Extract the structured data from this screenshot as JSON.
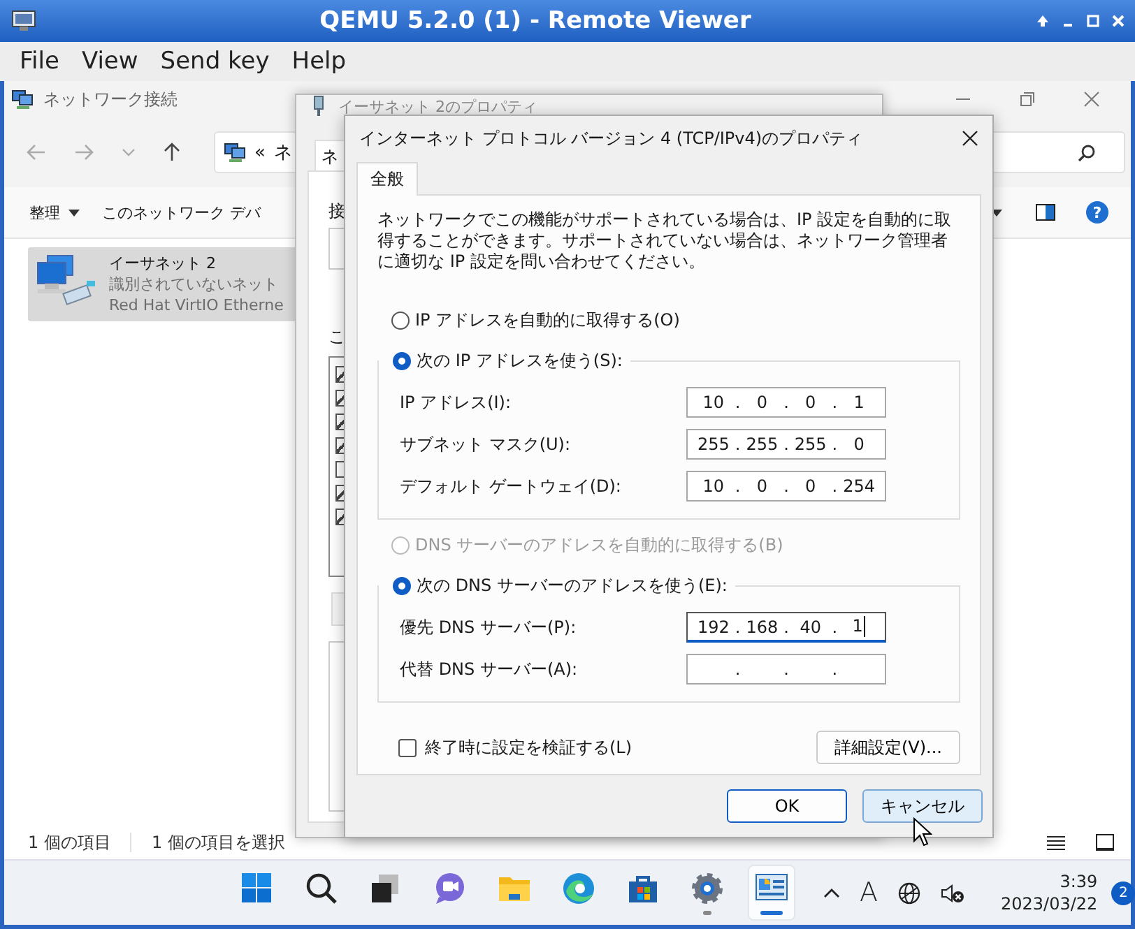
{
  "viewer": {
    "title": "QEMU 5.2.0 (1) - Remote Viewer",
    "menu": [
      "File",
      "View",
      "Send key",
      "Help"
    ]
  },
  "explorer": {
    "title": "ネットワーク接続",
    "address": [
      "«",
      "ネ"
    ],
    "toolbar": [
      {
        "label": "整理",
        "kind": "dropdown"
      },
      {
        "label": "このネットワーク デバ",
        "kind": "plain"
      }
    ],
    "help": "?",
    "items": [
      {
        "name": "イーサネット 2",
        "status": "識別されていないネット",
        "device": "Red Hat VirtIO Etherne",
        "selected": true
      }
    ],
    "status": [
      "1 個の項目",
      "1 個の項目を選択"
    ]
  },
  "back_dialog": {
    "title": "イーサネット 2のプロパティ",
    "tab": "ネ",
    "label_1": "接",
    "label_2": "こ",
    "checkboxes": [
      {
        "checked": true
      },
      {
        "checked": true
      },
      {
        "checked": true
      },
      {
        "checked": true
      },
      {
        "checked": false
      },
      {
        "checked": true
      },
      {
        "checked": true
      }
    ]
  },
  "dialog": {
    "title": "インターネット プロトコル バージョン 4 (TCP/IPv4)のプロパティ",
    "tabs": [
      {
        "label": "全般",
        "selected": true
      }
    ],
    "description": "ネットワークでこの機能がサポートされている場合は、IP 設定を自動的に取得することができます。サポートされていない場合は、ネットワーク管理者に適切な IP 設定を問い合わせてください。",
    "separator": ".",
    "ip_mode": [
      {
        "label": "IP アドレスを自動的に取得する(O)",
        "selected": false,
        "disabled": false
      },
      {
        "label": "次の IP アドレスを使う(S):",
        "selected": true,
        "disabled": false
      }
    ],
    "ip_fields": [
      {
        "label": "IP アドレス(I):",
        "octets": [
          "10",
          "0",
          "0",
          "1"
        ],
        "focused": false
      },
      {
        "label": "サブネット マスク(U):",
        "octets": [
          "255",
          "255",
          "255",
          "0"
        ],
        "focused": false
      },
      {
        "label": "デフォルト ゲートウェイ(D):",
        "octets": [
          "10",
          "0",
          "0",
          "254"
        ],
        "focused": false
      }
    ],
    "dns_mode": [
      {
        "label": "DNS サーバーのアドレスを自動的に取得する(B)",
        "selected": false,
        "disabled": true
      },
      {
        "label": "次の DNS サーバーのアドレスを使う(E):",
        "selected": true,
        "disabled": false
      }
    ],
    "dns_fields": [
      {
        "label": "優先 DNS サーバー(P):",
        "octets": [
          "192",
          "168",
          "40",
          "1"
        ],
        "focused": true
      },
      {
        "label": "代替 DNS サーバー(A):",
        "focused": false
      }
    ],
    "validate": {
      "label": "終了時に設定を検証する(L)",
      "checked": false
    },
    "advanced_button": "詳細設定(V)...",
    "buttons": [
      {
        "label": "OK",
        "kind": "default"
      },
      {
        "label": "キャンセル",
        "kind": "hover"
      }
    ]
  },
  "taskbar": {
    "apps": [
      {
        "kind": "start",
        "selected": false,
        "running": false
      },
      {
        "kind": "search",
        "selected": false,
        "running": false
      },
      {
        "kind": "taskview",
        "selected": false,
        "running": false
      },
      {
        "kind": "chat",
        "selected": false,
        "running": false
      },
      {
        "kind": "folder",
        "selected": false,
        "running": false
      },
      {
        "kind": "edge",
        "selected": false,
        "running": false
      },
      {
        "kind": "store",
        "selected": false,
        "running": false
      },
      {
        "kind": "settings",
        "selected": false,
        "running": true
      },
      {
        "kind": "control",
        "selected": true,
        "running": true
      }
    ],
    "ime": "A",
    "time": "3:39",
    "date": "2023/03/22",
    "notifications": "2"
  }
}
